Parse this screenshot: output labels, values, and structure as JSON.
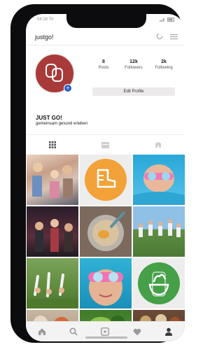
{
  "status": {
    "time": "04:28",
    "carrier": "Tri"
  },
  "topbar": {
    "brand": "justgo!"
  },
  "profile": {
    "posts_count": "8",
    "posts_label": "Posts",
    "followers_count": "12k",
    "followers_label": "Followers",
    "following_count": "2k",
    "following_label": "Following",
    "edit_label": "Edit Profile",
    "name": "JUST GO!",
    "bio": "gemeinsam gesund erleben"
  },
  "icons": {
    "settings": "spinner-icon",
    "menu": "hamburger-icon",
    "grid_tab": "grid-icon",
    "list_tab": "list-icon",
    "tagged_tab": "tagged-icon",
    "nav": [
      "home-icon",
      "search-icon",
      "add-icon",
      "heart-icon",
      "profile-icon"
    ]
  },
  "colors": {
    "avatar": "#a93a3a",
    "plus_badge": "#2f63c5",
    "orange": "#f2a238",
    "green": "#45a047"
  },
  "grid": [
    "girls-dancing-photo",
    "shoe-logo-tile",
    "pool-goggles-photo",
    "stage-performers-photo",
    "cooking-bowl-photo",
    "group-jumping-photo",
    "outdoor-yoga-photo",
    "goggles-kid-photo",
    "salad-logo-tile",
    "food-photo",
    "vegetables-photo",
    "spices-photo"
  ]
}
